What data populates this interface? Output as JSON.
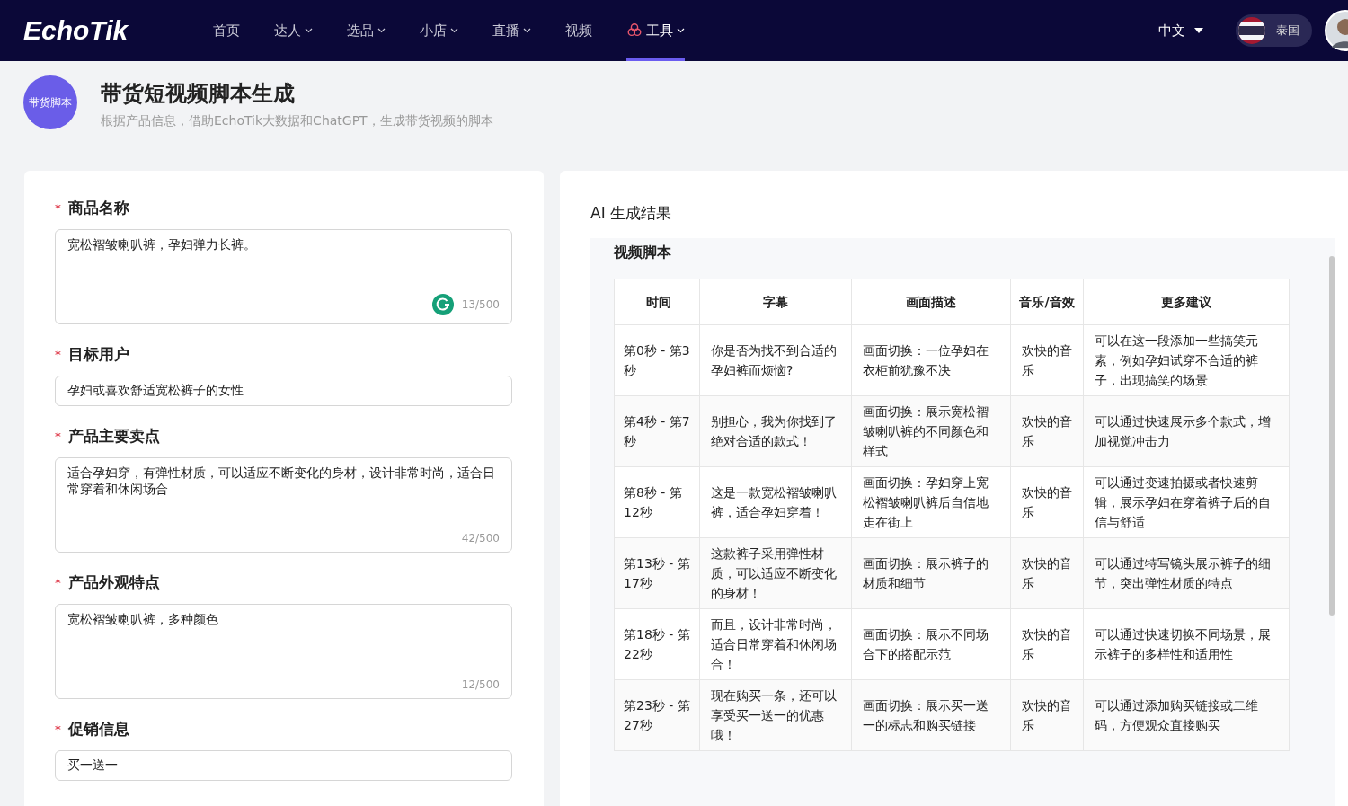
{
  "nav": {
    "logo": "EchoTik",
    "items": [
      {
        "label": "首页",
        "kind": "link",
        "dropdown": false,
        "selected": false
      },
      {
        "label": "达人",
        "kind": "link",
        "dropdown": true,
        "selected": false
      },
      {
        "label": "选品",
        "kind": "link",
        "dropdown": true,
        "selected": false
      },
      {
        "label": "小店",
        "kind": "link",
        "dropdown": true,
        "selected": false
      },
      {
        "label": "直播",
        "kind": "link",
        "dropdown": true,
        "selected": false
      },
      {
        "label": "视频",
        "kind": "link",
        "dropdown": false,
        "selected": false
      },
      {
        "label": "工具",
        "kind": "ai-tool",
        "dropdown": true,
        "selected": true
      }
    ],
    "language": "中文",
    "region": "泰国"
  },
  "header": {
    "badge": "带货脚本",
    "title": "带货短视频脚本生成",
    "subtitle": "根据产品信息，借助EchoTik大数据和ChatGPT，生成带货视频的脚本"
  },
  "form": {
    "fields": [
      {
        "label": "商品名称",
        "marker": "*",
        "kind": "textarea",
        "value": "宽松褶皱喇叭裤，孕妇弹力长裤。",
        "counter": "13/500"
      },
      {
        "label": "目标用户",
        "marker": "*",
        "kind": "input",
        "value": "孕妇或喜欢舒适宽松裤子的女性"
      },
      {
        "label": "产品主要卖点",
        "marker": "*",
        "kind": "textarea",
        "value": "适合孕妇穿，有弹性材质，可以适应不断变化的身材，设计非常时尚，适合日常穿着和休闲场合",
        "counter": "42/500"
      },
      {
        "label": "产品外观特点",
        "marker": "*",
        "kind": "textarea",
        "value": "宽松褶皱喇叭裤，多种颜色",
        "counter": "12/500"
      },
      {
        "label": "促销信息",
        "marker": "*",
        "kind": "input",
        "value": "买一送一"
      }
    ]
  },
  "result": {
    "title": "AI 生成结果",
    "section": "视频脚本",
    "table": {
      "columns": [
        "时间",
        "字幕",
        "画面描述",
        "音乐/音效",
        "更多建议"
      ],
      "rows": [
        [
          "第0秒 - 第3秒",
          "你是否为找不到合适的孕妇裤而烦恼?",
          "画面切换：一位孕妇在衣柜前犹豫不决",
          "欢快的音乐",
          "可以在这一段添加一些搞笑元素，例如孕妇试穿不合适的裤子，出现搞笑的场景"
        ],
        [
          "第4秒 - 第7秒",
          "别担心，我为你找到了绝对合适的款式！",
          "画面切换：展示宽松褶皱喇叭裤的不同颜色和样式",
          "欢快的音乐",
          "可以通过快速展示多个款式，增加视觉冲击力"
        ],
        [
          "第8秒 - 第12秒",
          "这是一款宽松褶皱喇叭裤，适合孕妇穿着！",
          "画面切换：孕妇穿上宽松褶皱喇叭裤后自信地走在街上",
          "欢快的音乐",
          "可以通过变速拍摄或者快速剪辑，展示孕妇在穿着裤子后的自信与舒适"
        ],
        [
          "第13秒 - 第17秒",
          "这款裤子采用弹性材质，可以适应不断变化的身材！",
          "画面切换：展示裤子的材质和细节",
          "欢快的音乐",
          "可以通过特写镜头展示裤子的细节，突出弹性材质的特点"
        ],
        [
          "第18秒 - 第22秒",
          "而且，设计非常时尚，适合日常穿着和休闲场合！",
          "画面切换：展示不同场合下的搭配示范",
          "欢快的音乐",
          "可以通过快速切换不同场景，展示裤子的多样性和适用性"
        ],
        [
          "第23秒 - 第27秒",
          "现在购买一条，还可以享受买一送一的优惠哦！",
          "画面切换：展示买一送一的标志和购买链接",
          "欢快的音乐",
          "可以通过添加购买链接或二维码，方便观众直接购买"
        ]
      ]
    }
  }
}
